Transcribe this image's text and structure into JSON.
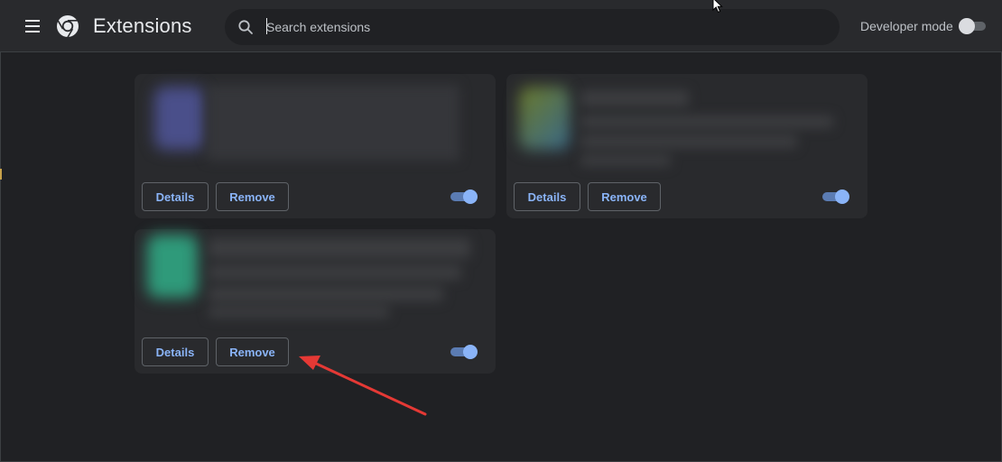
{
  "window": {
    "title": "Extensions"
  },
  "header": {
    "menu_icon": "hamburger-menu-icon",
    "logo_icon": "chrome-logo-icon",
    "title": "Extensions",
    "search": {
      "placeholder": "Search extensions",
      "value": "",
      "icon": "search-icon"
    },
    "developer_mode": {
      "label": "Developer mode",
      "enabled": false
    }
  },
  "extensions": [
    {
      "details_label": "Details",
      "remove_label": "Remove",
      "enabled": true,
      "icon_color": "#4a4f8a"
    },
    {
      "details_label": "Details",
      "remove_label": "Remove",
      "enabled": true,
      "icon_color": "#3a6a8a"
    },
    {
      "details_label": "Details",
      "remove_label": "Remove",
      "enabled": true,
      "icon_color": "#2f9a7a"
    }
  ],
  "annotation": {
    "type": "arrow",
    "color": "#e53935",
    "target": "remove-button"
  },
  "colors": {
    "background": "#202124",
    "toolbar": "#292a2d",
    "card": "#292a2d",
    "accent": "#8ab4f8",
    "toggle_track_on": "#5b7cb3"
  }
}
